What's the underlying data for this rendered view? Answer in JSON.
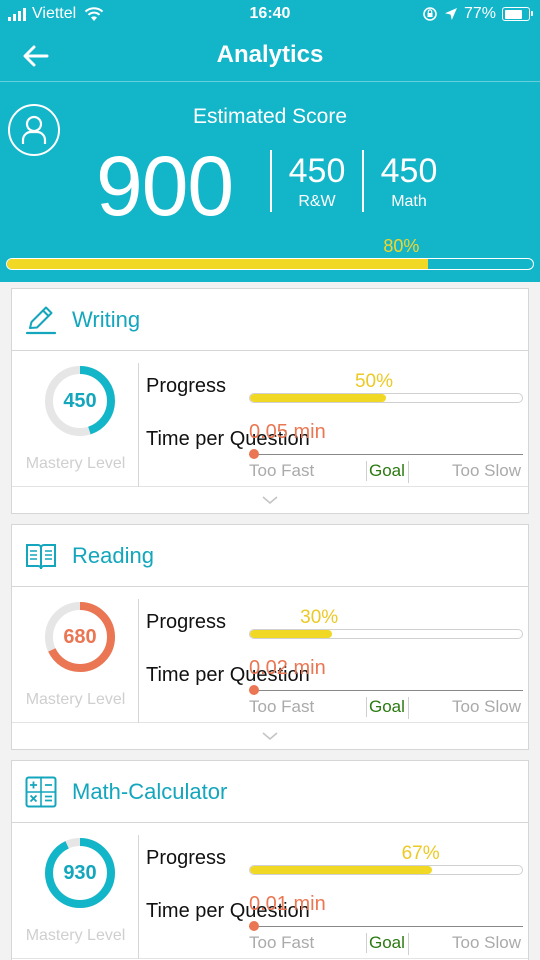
{
  "status": {
    "carrier": "Viettel",
    "time": "16:40",
    "battery": "77%",
    "battery_level": 0.77
  },
  "nav": {
    "title": "Analytics",
    "back_icon": "arrow-left-icon"
  },
  "summary": {
    "label": "Estimated Score",
    "total": "900",
    "sections": [
      {
        "score": "450",
        "label": "R&W"
      },
      {
        "score": "450",
        "label": "Math"
      }
    ],
    "progress_text": "80%",
    "progress": 0.8
  },
  "colors": {
    "accent": "#13b5c9",
    "progress_fill": "#f1d824",
    "time_color": "#ea7653",
    "goal_color": "#2a7a10",
    "writing_ring": "#13b5c9",
    "reading_ring": "#ea7653",
    "math_ring": "#13b5c9"
  },
  "subjects": [
    {
      "title": "Writing",
      "icon": "pencil-icon",
      "score": "450",
      "ring_fraction": 0.45,
      "ring_color": "#13b5c9",
      "score_color": "#13a6bc",
      "mastery_label": "Mastery Level",
      "progress_label": "Progress",
      "progress_text": "50%",
      "progress": 0.5,
      "time_label": "Time per Question",
      "time_value": "0.05 min",
      "too_fast": "Too Fast",
      "goal": "Goal",
      "too_slow": "Too Slow"
    },
    {
      "title": "Reading",
      "icon": "book-icon",
      "score": "680",
      "ring_fraction": 0.68,
      "ring_color": "#ea7653",
      "score_color": "#ea7653",
      "mastery_label": "Mastery Level",
      "progress_label": "Progress",
      "progress_text": "30%",
      "progress": 0.3,
      "time_label": "Time per Question",
      "time_value": "0.02 min",
      "too_fast": "Too Fast",
      "goal": "Goal",
      "too_slow": "Too Slow"
    },
    {
      "title": "Math-Calculator",
      "icon": "calculator-icon",
      "score": "930",
      "ring_fraction": 0.93,
      "ring_color": "#13b5c9",
      "score_color": "#13a6bc",
      "mastery_label": "Mastery Level",
      "progress_label": "Progress",
      "progress_text": "67%",
      "progress": 0.67,
      "time_label": "Time per Question",
      "time_value": "0.01 min",
      "too_fast": "Too Fast",
      "goal": "Goal",
      "too_slow": "Too Slow"
    }
  ]
}
